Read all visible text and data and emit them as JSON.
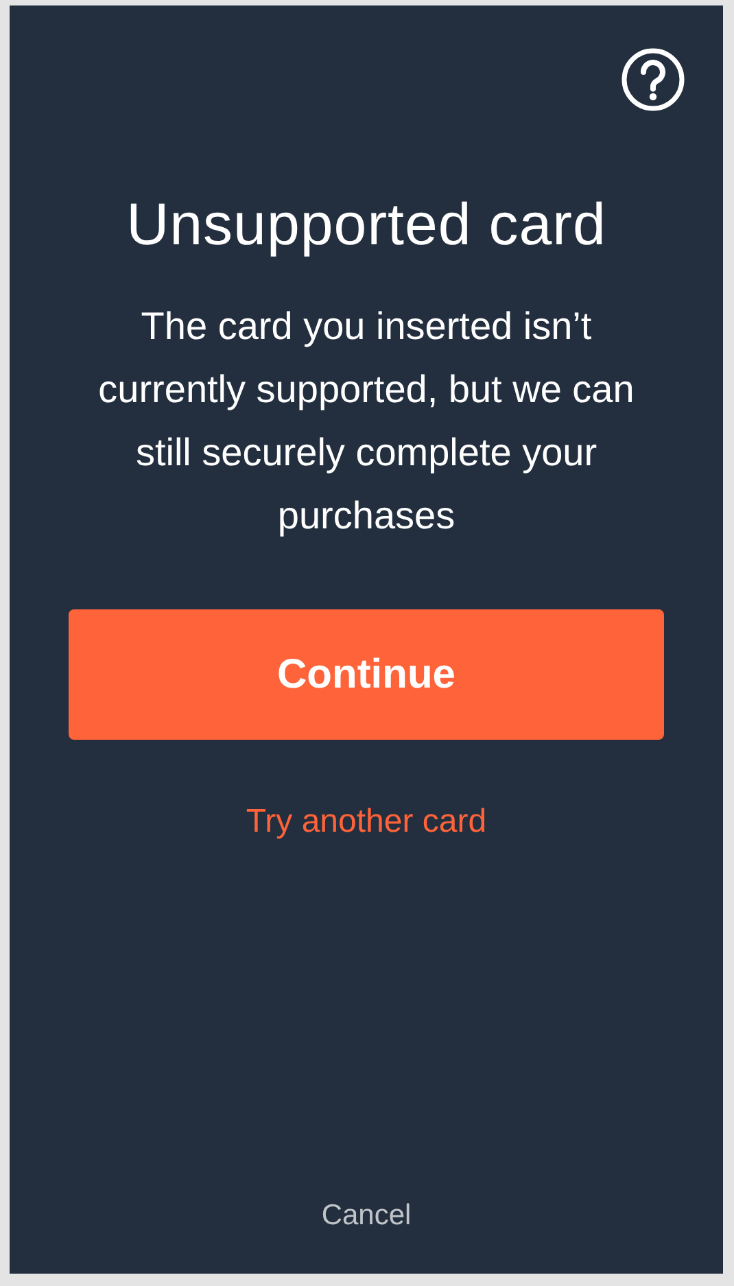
{
  "title": "Unsupported card",
  "message": "The card you inserted isn’t currently supported, but we can still securely complete your purchases",
  "primary_button": "Continue",
  "link": "Try another card",
  "cancel": "Cancel"
}
